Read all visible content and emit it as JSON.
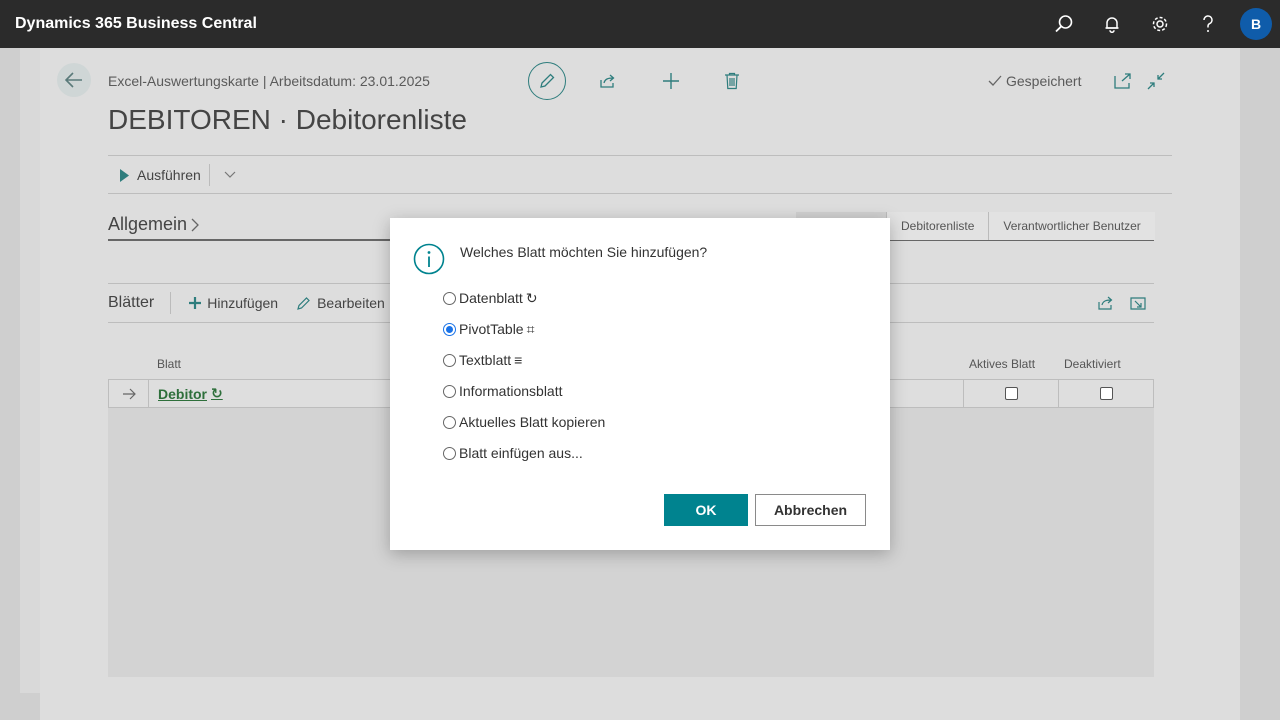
{
  "appbar": {
    "title": "Dynamics 365 Business Central",
    "user_initial": "B"
  },
  "header": {
    "breadcrumb": "Excel-Auswertungskarte | Arbeitsdatum: 23.01.2025",
    "title": "DEBITOREN · Debitorenliste",
    "status": "Gespeichert"
  },
  "actions": {
    "run_label": "Ausführen"
  },
  "general": {
    "section_title": "Allgemein",
    "tabs": [
      "",
      "Debitorenliste",
      "Verantwortlicher Benutzer"
    ]
  },
  "sheets": {
    "title": "Blätter",
    "add_label": "Hinzufügen",
    "edit_label": "Bearbeiten",
    "columns": {
      "sheet": "Blatt",
      "active": "Aktives Blatt",
      "disabled": "Deaktiviert"
    },
    "rows": [
      {
        "name": "Debitor",
        "active": false,
        "disabled": false
      }
    ]
  },
  "dialog": {
    "question": "Welches Blatt möchten Sie hinzufügen?",
    "options": [
      {
        "label": "Datenblatt",
        "glyph": "↻",
        "selected": false
      },
      {
        "label": "PivotTable",
        "glyph": "⌗",
        "selected": true
      },
      {
        "label": "Textblatt",
        "glyph": "≡",
        "selected": false
      },
      {
        "label": "Informationsblatt",
        "glyph": "",
        "selected": false
      },
      {
        "label": "Aktuelles Blatt kopieren",
        "glyph": "",
        "selected": false
      },
      {
        "label": "Blatt einfügen aus...",
        "glyph": "",
        "selected": false
      }
    ],
    "ok_label": "OK",
    "cancel_label": "Abbrechen"
  },
  "colors": {
    "appbar": "#2b2b2b",
    "accent": "#00838f",
    "avatar": "#0f5caa",
    "link_green": "#2e6f3b"
  }
}
